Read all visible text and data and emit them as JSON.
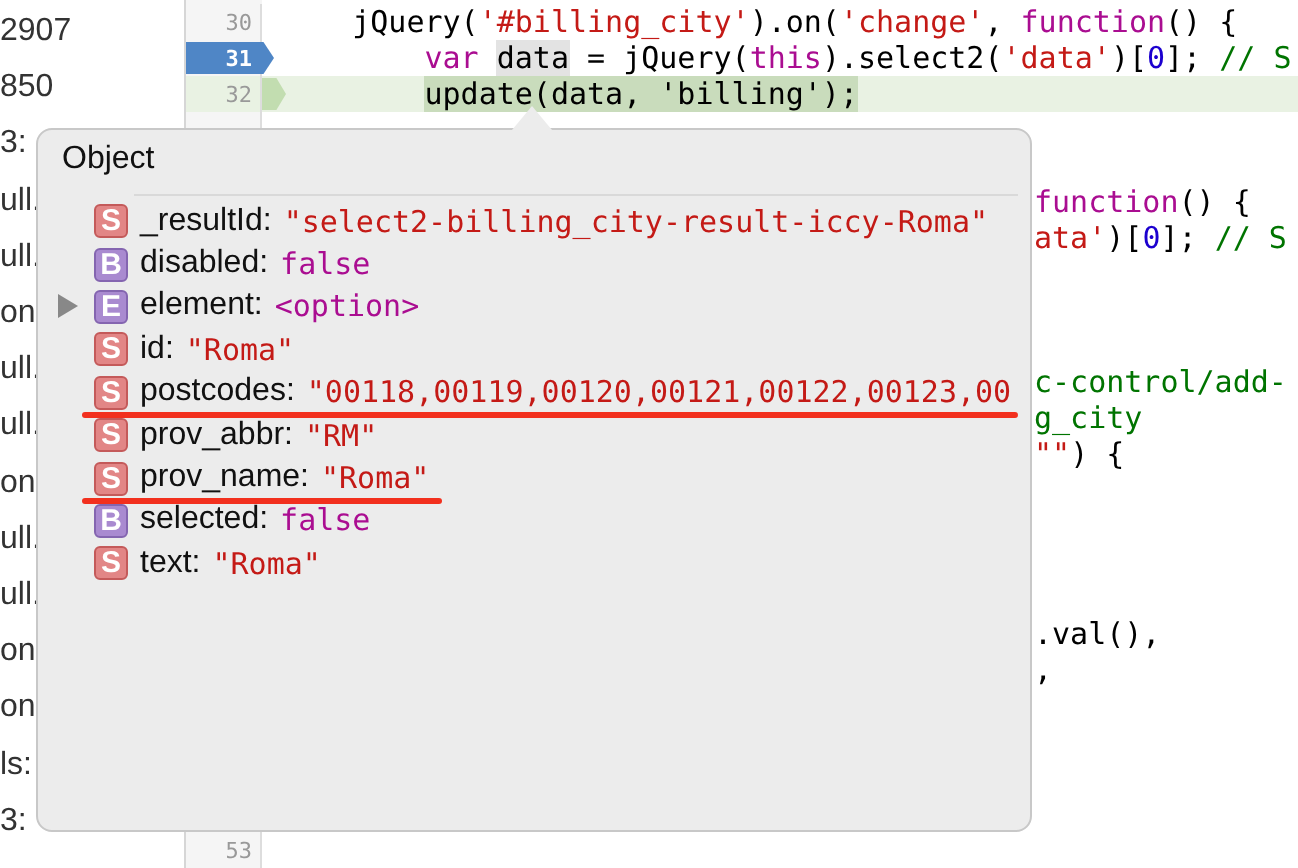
{
  "left_panel": {
    "fragments": [
      "2907",
      "850",
      "3:",
      "ull.",
      "ull.",
      "on",
      "ull.",
      "ull.",
      "on",
      "ull.",
      "ull.",
      "on",
      "on",
      "ls:",
      "3:"
    ]
  },
  "editor": {
    "rows": [
      {
        "number": "30",
        "breakpoint": false,
        "current": false,
        "tokens": [
          {
            "kind": "plain",
            "text": "    jQuery("
          },
          {
            "kind": "string",
            "text": "'#billing_city'"
          },
          {
            "kind": "plain",
            "text": ").on("
          },
          {
            "kind": "string",
            "text": "'change'"
          },
          {
            "kind": "plain",
            "text": ", "
          },
          {
            "kind": "keyword",
            "text": "function"
          },
          {
            "kind": "plain",
            "text": "() {"
          }
        ]
      },
      {
        "number": "31",
        "breakpoint": true,
        "current": false,
        "tokens": [
          {
            "kind": "keyword",
            "text": "        var "
          },
          {
            "kind": "hover",
            "text": "data"
          },
          {
            "kind": "plain",
            "text": " = jQuery("
          },
          {
            "kind": "keyword",
            "text": "this"
          },
          {
            "kind": "plain",
            "text": ").select2("
          },
          {
            "kind": "string",
            "text": "'data'"
          },
          {
            "kind": "plain",
            "text": ")["
          },
          {
            "kind": "number",
            "text": "0"
          },
          {
            "kind": "plain",
            "text": "]; "
          },
          {
            "kind": "comment",
            "text": "// S"
          }
        ]
      },
      {
        "number": "32",
        "breakpoint": false,
        "current": true,
        "tokens": [
          {
            "kind": "statement",
            "text": "        update(data, 'billing');"
          }
        ]
      },
      {},
      {},
      {
        "tail": [
          {
            "kind": "keyword",
            "text": "function"
          },
          {
            "kind": "plain",
            "text": "() {"
          }
        ]
      },
      {
        "tail": [
          {
            "kind": "string",
            "text": "ata'"
          },
          {
            "kind": "plain",
            "text": ")["
          },
          {
            "kind": "number",
            "text": "0"
          },
          {
            "kind": "plain",
            "text": "]; "
          },
          {
            "kind": "comment",
            "text": "// S"
          }
        ]
      },
      {},
      {},
      {},
      {
        "tail": [
          {
            "kind": "comment",
            "text": "c-control/add-"
          }
        ]
      },
      {
        "tail": [
          {
            "kind": "comment",
            "text": "g_city"
          }
        ]
      },
      {
        "tail": [
          {
            "kind": "string",
            "text": "\"\""
          },
          {
            "kind": "plain",
            "text": ") {"
          }
        ]
      },
      {},
      {},
      {},
      {},
      {
        "tail": [
          {
            "kind": "plain",
            "text": ".val(),"
          }
        ]
      },
      {
        "tail": [
          {
            "kind": "plain",
            "text": ","
          }
        ]
      },
      {},
      {},
      {},
      {},
      {
        "number": "53",
        "breakpoint": false,
        "current": false,
        "tokens": []
      }
    ]
  },
  "popover": {
    "title": "Object",
    "properties": [
      {
        "type": "S",
        "key": "_resultId:",
        "value": "\"select2-billing_city-result-iccy-Roma\"",
        "expandable": false,
        "underlined": false
      },
      {
        "type": "B",
        "key": "disabled:",
        "value": "false",
        "expandable": false,
        "underlined": false
      },
      {
        "type": "E",
        "key": "element:",
        "value": "<option>",
        "expandable": true,
        "underlined": false
      },
      {
        "type": "S",
        "key": "id:",
        "value": "\"Roma\"",
        "expandable": false,
        "underlined": false
      },
      {
        "type": "S",
        "key": "postcodes:",
        "value": "\"00118,00119,00120,00121,00122,00123,00",
        "expandable": false,
        "underlined": true
      },
      {
        "type": "S",
        "key": "prov_abbr:",
        "value": "\"RM\"",
        "expandable": false,
        "underlined": false
      },
      {
        "type": "S",
        "key": "prov_name:",
        "value": "\"Roma\"",
        "expandable": false,
        "underlined": true
      },
      {
        "type": "B",
        "key": "selected:",
        "value": "false",
        "expandable": false,
        "underlined": false
      },
      {
        "type": "S",
        "key": "text:",
        "value": "\"Roma\"",
        "expandable": false,
        "underlined": false
      }
    ]
  }
}
